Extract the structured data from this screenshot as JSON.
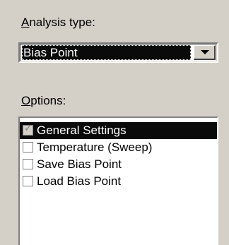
{
  "analysis_type": {
    "label_accel": "A",
    "label_rest": "nalysis type:",
    "selected_value": "Bias Point"
  },
  "options": {
    "label_accel": "O",
    "label_rest": "ptions:",
    "items": [
      {
        "label": "General Settings",
        "checked": true,
        "selected": true
      },
      {
        "label": "Temperature (Sweep)",
        "checked": false,
        "selected": false
      },
      {
        "label": "Save Bias Point",
        "checked": false,
        "selected": false
      },
      {
        "label": "Load Bias Point",
        "checked": false,
        "selected": false
      }
    ]
  },
  "icons": {
    "dropdown_arrow": "chevron-down-icon",
    "checkmark_glyph": "✓"
  }
}
